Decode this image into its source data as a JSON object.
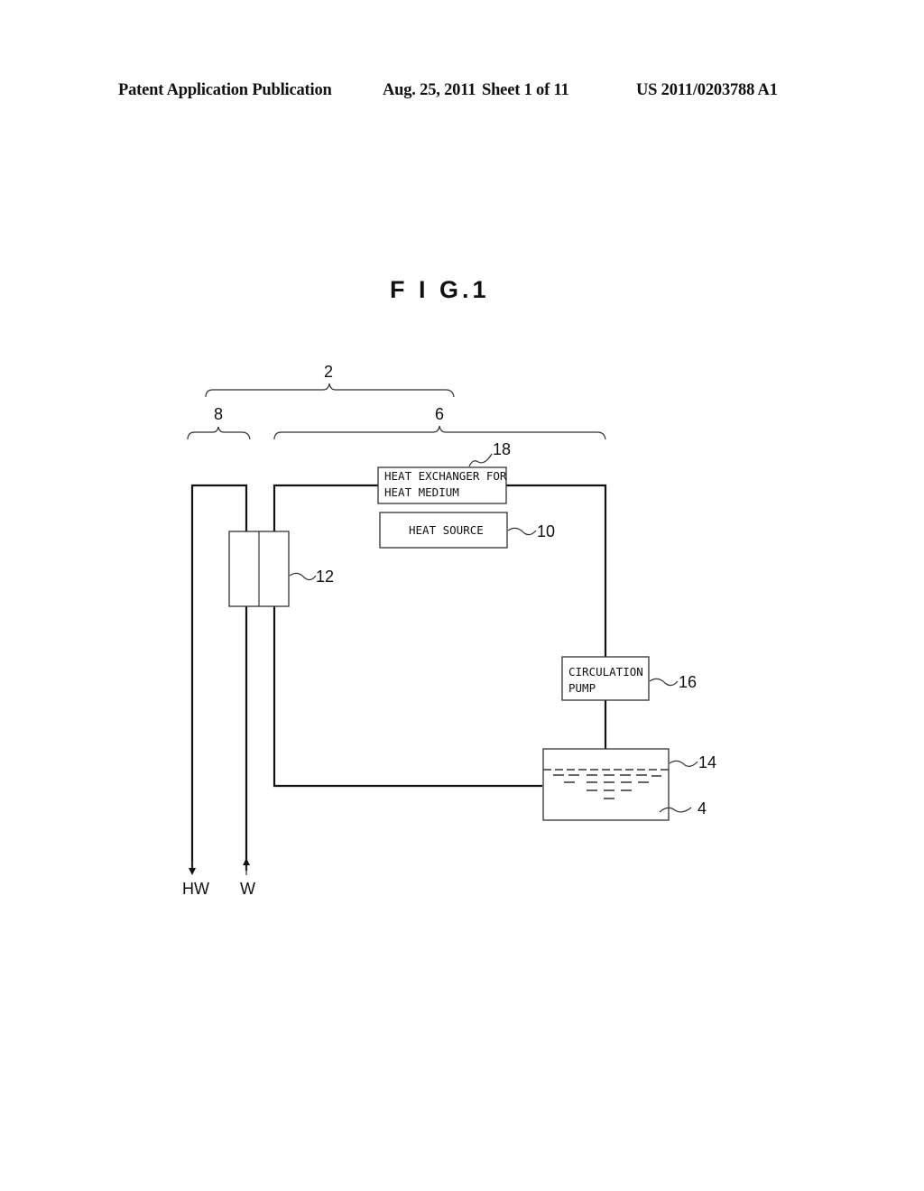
{
  "header": {
    "publication": "Patent Application Publication",
    "date": "Aug. 25, 2011",
    "sheet": "Sheet 1 of 11",
    "number": "US 2011/0203788 A1"
  },
  "figure": {
    "title": "F I G.1",
    "braces": {
      "system": "2",
      "water_side": "8",
      "medium_side": "6"
    },
    "components": {
      "heat_exchanger_medium": {
        "ref": "18",
        "line1": "HEAT EXCHANGER FOR",
        "line2": "HEAT MEDIUM"
      },
      "heat_source": {
        "ref": "10",
        "label": "HEAT SOURCE"
      },
      "water_heat_exchanger": {
        "ref": "12"
      },
      "circulation_pump": {
        "ref": "16",
        "line1": "CIRCULATION",
        "line2": "PUMP"
      },
      "tank": {
        "ref": "14"
      },
      "heat_medium": {
        "ref": "4"
      }
    },
    "io": {
      "hot_water_out": "HW",
      "water_in": "W"
    }
  }
}
